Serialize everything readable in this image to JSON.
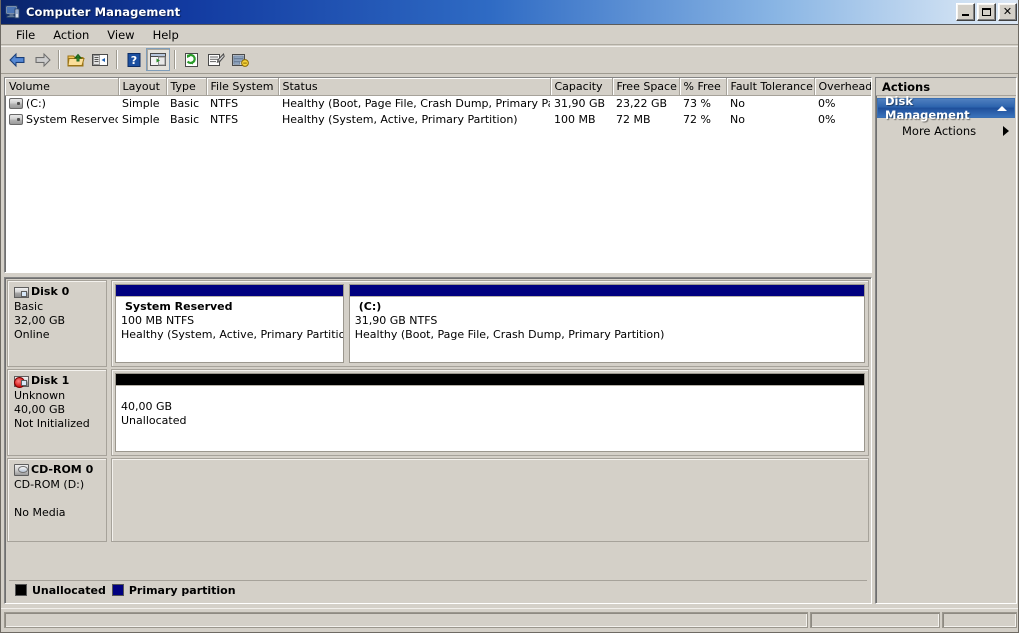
{
  "window": {
    "title": "Computer Management",
    "icon": "computer-management-icon",
    "buttons": {
      "minimize": "_",
      "maximize": "□",
      "close": "✕"
    }
  },
  "menubar": {
    "items": [
      {
        "label": "File",
        "name": "menu-file"
      },
      {
        "label": "Action",
        "name": "menu-action"
      },
      {
        "label": "View",
        "name": "menu-view"
      },
      {
        "label": "Help",
        "name": "menu-help"
      }
    ]
  },
  "toolbar": {
    "buttons": [
      {
        "name": "back-button",
        "icon": "back-arrow-icon",
        "title": "Back"
      },
      {
        "name": "forward-button",
        "icon": "forward-arrow-icon",
        "title": "Forward"
      },
      {
        "name": "up-one-level-button",
        "icon": "up-folder-icon",
        "title": "Up One Level"
      },
      {
        "name": "show-hide-tree-button",
        "icon": "console-tree-icon",
        "title": "Show/Hide Console Tree"
      },
      {
        "name": "help-button",
        "icon": "help-question-icon",
        "title": "Help"
      },
      {
        "name": "show-hide-action-pane-button",
        "icon": "action-pane-icon",
        "title": "Show/Hide Action Pane"
      },
      {
        "name": "refresh-button",
        "icon": "refresh-icon",
        "title": "Refresh"
      },
      {
        "name": "properties-button",
        "icon": "properties-icon",
        "title": "Properties"
      },
      {
        "name": "rescan-disks-button",
        "icon": "rescan-disks-icon",
        "title": "Rescan Disks"
      }
    ]
  },
  "volume_list": {
    "columns": [
      "Volume",
      "Layout",
      "Type",
      "File System",
      "Status",
      "Capacity",
      "Free Space",
      "% Free",
      "Fault Tolerance",
      "Overhead"
    ],
    "rows": [
      {
        "volume": "(C:)",
        "icon": "drive-icon",
        "layout": "Simple",
        "type": "Basic",
        "file_system": "NTFS",
        "status": "Healthy (Boot, Page File, Crash Dump, Primary Partition)",
        "capacity": "31,90 GB",
        "free_space": "23,22 GB",
        "percent_free": "73 %",
        "fault_tolerance": "No",
        "overhead": "0%"
      },
      {
        "volume": "System Reserved",
        "icon": "drive-icon",
        "layout": "Simple",
        "type": "Basic",
        "file_system": "NTFS",
        "status": "Healthy (System, Active, Primary Partition)",
        "capacity": "100 MB",
        "free_space": "72 MB",
        "percent_free": "72 %",
        "fault_tolerance": "No",
        "overhead": "0%"
      }
    ]
  },
  "disk_view": {
    "disks": [
      {
        "name": "Disk 0",
        "icon": "disk-icon",
        "type": "Basic",
        "size": "32,00 GB",
        "state": "Online",
        "partitions": [
          {
            "title": "System Reserved",
            "size_fs": "100 MB NTFS",
            "status": "Healthy (System, Active, Primary Partition)",
            "bar": "primary",
            "width_pct": 30.5
          },
          {
            "title": "(C:)",
            "size_fs": "31,90 GB NTFS",
            "status": "Healthy (Boot, Page File, Crash Dump, Primary Partition)",
            "bar": "primary",
            "width_pct": 69.5
          }
        ]
      },
      {
        "name": "Disk 1",
        "icon": "disk-warning-icon",
        "type": "Unknown",
        "size": "40,00 GB",
        "state": "Not Initialized",
        "partitions": [
          {
            "title": "",
            "size_fs": "40,00 GB",
            "status": "Unallocated",
            "bar": "unalloc",
            "width_pct": 100
          }
        ]
      },
      {
        "name": "CD-ROM 0",
        "icon": "cdrom-icon",
        "type": "CD-ROM (D:)",
        "size": "",
        "state": "No Media",
        "partitions": []
      }
    ],
    "legend": [
      {
        "swatch": "black",
        "label": "Unallocated"
      },
      {
        "swatch": "navy",
        "label": "Primary partition"
      }
    ]
  },
  "actions": {
    "title": "Actions",
    "group_header": "Disk Management",
    "items": [
      {
        "label": "More Actions",
        "name": "action-more-actions"
      }
    ]
  },
  "statusbar": {
    "pane1": "",
    "pane2": "",
    "pane3": ""
  },
  "colors": {
    "primary_partition": "#00007f",
    "unallocated": "#000000",
    "window_face": "#d4d0c8",
    "title_start": "#0a246a",
    "action_header": "#2c63ad"
  }
}
